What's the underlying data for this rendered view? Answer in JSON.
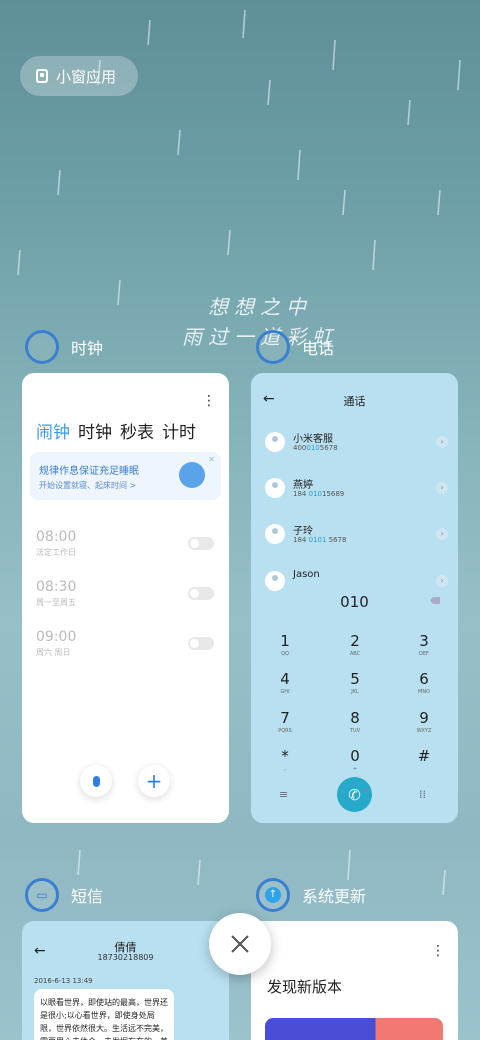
{
  "small_window": {
    "label": "小窗应用",
    "icon": "small-window-icon"
  },
  "wallpaper": {
    "poem_line1": "想想之中",
    "poem_line2": "雨过一道彩虹"
  },
  "apps": {
    "clock": {
      "name": "时钟",
      "icon": "clock-icon"
    },
    "phone": {
      "name": "电话",
      "icon": "phone-icon"
    },
    "sms": {
      "name": "短信",
      "icon": "message-icon"
    },
    "update": {
      "name": "系统更新",
      "icon": "update-arrow-icon"
    }
  },
  "clock_card": {
    "tabs": [
      "闹钟",
      "时钟",
      "秒表",
      "计时"
    ],
    "banner": {
      "title": "规律作息保证充足睡眠",
      "subtitle": "开始设置就寝、起床时间 >"
    },
    "alarms": [
      {
        "time": "08:00",
        "repeat": "法定工作日",
        "enabled": false
      },
      {
        "time": "08:30",
        "repeat": "周一至周五",
        "enabled": false
      },
      {
        "time": "09:00",
        "repeat": "周六 周日",
        "enabled": false
      }
    ]
  },
  "phone_card": {
    "title": "通话",
    "contacts": [
      {
        "name": "小米客服",
        "num_a": "400",
        "num_b": "010",
        "num_c": "5678"
      },
      {
        "name": "燕婷",
        "num_a": "184 ",
        "num_b": "010",
        "num_c": "15689"
      },
      {
        "name": "子玲",
        "num_a": "184 ",
        "num_b": "0101",
        "num_c": " 5678"
      },
      {
        "name": "Jason",
        "num_a": "",
        "num_b": "",
        "num_c": ""
      }
    ],
    "dial_input": "010",
    "keys": [
      {
        "d": "1",
        "l": "QQ"
      },
      {
        "d": "2",
        "l": "ABC"
      },
      {
        "d": "3",
        "l": "DEF"
      },
      {
        "d": "4",
        "l": "GHI"
      },
      {
        "d": "5",
        "l": "JKL"
      },
      {
        "d": "6",
        "l": "MNO"
      },
      {
        "d": "7",
        "l": "PQRS"
      },
      {
        "d": "8",
        "l": "TUV"
      },
      {
        "d": "9",
        "l": "WXYZ"
      },
      {
        "d": "*",
        "l": ","
      },
      {
        "d": "0",
        "l": "+"
      },
      {
        "d": "#",
        "l": ""
      }
    ]
  },
  "sms_card": {
    "contact_name": "倩倩",
    "contact_number": "18730218809",
    "timestamp": "2016-6-13 13:49",
    "message": "以眼看世界，即使站的最高，世界还是很小;以心看世界，即使身处局限，世界依然很大。生活远不完美，需要用心去体会，去发掘存在的，美"
  },
  "update_card": {
    "heading": "发现新版本"
  },
  "colors": {
    "accent": "#3a9ce8",
    "call_button": "#27a9c9",
    "phone_bg": "#b9e0f1"
  }
}
